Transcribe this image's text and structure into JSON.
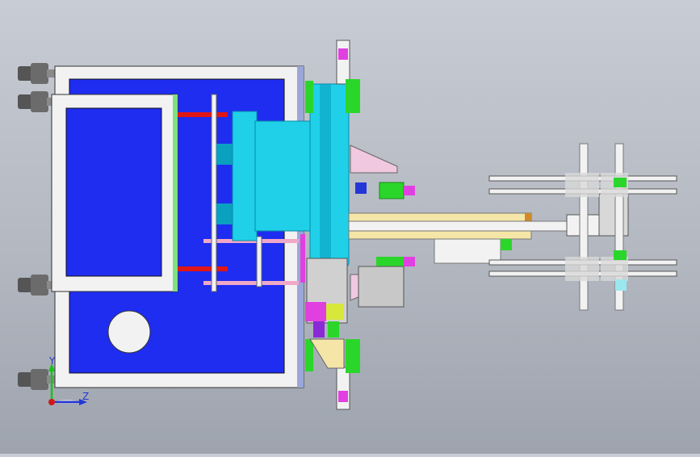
{
  "viewport": {
    "background_top": "#c8ccd4",
    "background_bottom": "#9ea4ae"
  },
  "triad": {
    "y_label": "Y",
    "z_label": "Z",
    "y_color": "#19c21a",
    "z_color": "#2436d6",
    "origin_color": "#d01818"
  },
  "colors": {
    "blue_panel": "#1e2df0",
    "frame_white": "#f2f2f2",
    "cyan_body": "#1fd0e8",
    "cyan_dark": "#0aa0c0",
    "green_part": "#2bd62b",
    "magenta_part": "#e040e0",
    "yellow_rail": "#f5e6a8",
    "red_rod": "#e01616",
    "pink_rod": "#f0a8c8"
  },
  "icons": [
    "axis-triad-icon",
    "leveling-foot-icon"
  ]
}
